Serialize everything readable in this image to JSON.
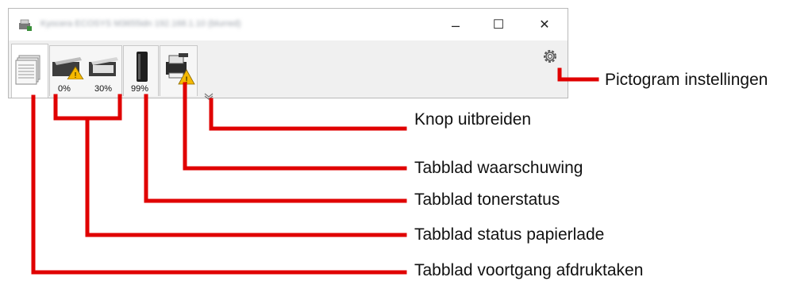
{
  "window": {
    "title": "Kyocera ECOSYS M3655idn 192.168.1.10 (blurred)",
    "controls": {
      "minimize": "–",
      "maximize": "☐",
      "close": "✕"
    }
  },
  "tabs": {
    "paper_tray_1_pct": "0%",
    "paper_tray_2_pct": "30%",
    "toner_pct": "99%"
  },
  "annotations": {
    "settings_icon": "Pictogram instellingen",
    "expand_button": "Knop uitbreiden",
    "alert_tab": "Tabblad waarschuwing",
    "toner_tab": "Tabblad tonerstatus",
    "paper_tab": "Tabblad status papierlade",
    "jobs_tab": "Tabblad voortgang afdruktaken"
  },
  "colors": {
    "annotation_line": "#e00000",
    "warning": "#f5b800"
  }
}
